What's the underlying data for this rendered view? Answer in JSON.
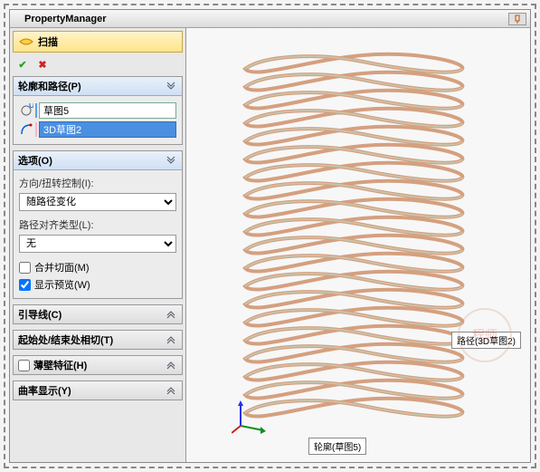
{
  "header": {
    "title": "PropertyManager"
  },
  "command": {
    "label": "扫描"
  },
  "sections": {
    "profile_path": {
      "title": "轮廓和路径(P)",
      "profile": "草图5",
      "path": "3D草图2"
    },
    "options": {
      "title": "选项(O)",
      "twist_label": "方向/扭转控制(I):",
      "twist_value": "随路径变化",
      "align_label": "路径对齐类型(L):",
      "align_value": "无",
      "merge_label": "合并切面(M)",
      "preview_label": "显示预览(W)"
    },
    "guides": {
      "title": "引导线(C)"
    },
    "tangency": {
      "title": "起始处/结束处相切(T)"
    },
    "thin": {
      "title": "薄壁特征(H)"
    },
    "curvature": {
      "title": "曲率显示(Y)"
    }
  },
  "callouts": {
    "path": "路径(3D草图2)",
    "profile": "轮廓(草图5)"
  }
}
